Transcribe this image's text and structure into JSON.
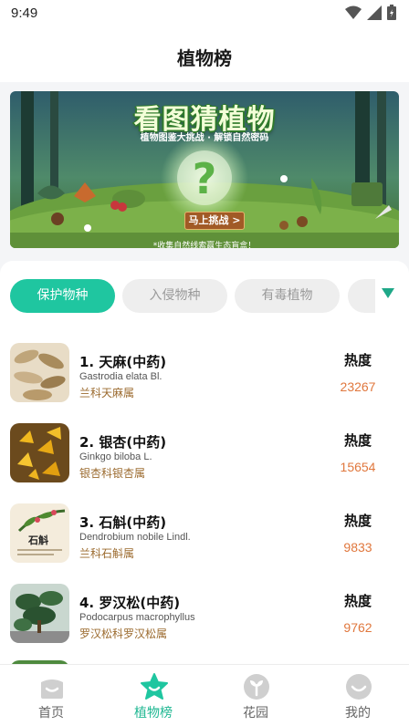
{
  "status_bar": {
    "time": "9:49"
  },
  "header": {
    "title": "植物榜"
  },
  "banner": {
    "title": "看图猜植物",
    "subtitle": "植物图鉴大挑战 · 解锁自然密码",
    "button_label": "马上挑战 >",
    "caption": "*收集自然线索赢生态盲盒！"
  },
  "filters": [
    {
      "label": "保护物种",
      "active": true
    },
    {
      "label": "入侵物种",
      "active": false
    },
    {
      "label": "有毒植物",
      "active": false
    }
  ],
  "list": {
    "heat_label": "热度",
    "items": [
      {
        "name": "1. 天麻(中药)",
        "latin": "Gastrodia elata Bl.",
        "family": "兰科天麻属",
        "heat": "23267"
      },
      {
        "name": "2. 银杏(中药)",
        "latin": "Ginkgo biloba L.",
        "family": "银杏科银杏属",
        "heat": "15654"
      },
      {
        "name": "3. 石斛(中药)",
        "latin": "Dendrobium nobile Lindl.",
        "family": "兰科石斛属",
        "heat": "9833",
        "thumb_text": "石斛"
      },
      {
        "name": "4. 罗汉松(中药)",
        "latin": "Podocarpus macrophyllus",
        "family": "罗汉松科罗汉松属",
        "heat": "9762"
      }
    ]
  },
  "tabbar": {
    "tabs": [
      {
        "label": "首页",
        "icon": "home-icon",
        "active": false
      },
      {
        "label": "植物榜",
        "icon": "star-icon",
        "active": true
      },
      {
        "label": "花园",
        "icon": "sprout-icon",
        "active": false
      },
      {
        "label": "我的",
        "icon": "profile-icon",
        "active": false
      }
    ]
  },
  "colors": {
    "accent": "#1fc6a0",
    "heat": "#e0773d",
    "family": "#9b6a2e"
  }
}
